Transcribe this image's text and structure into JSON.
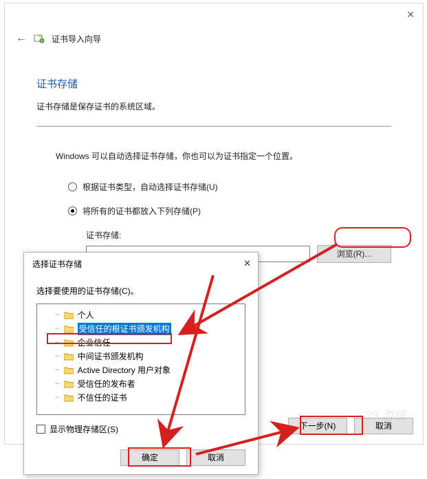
{
  "wizard": {
    "title": "证书导入向导",
    "heading": "证书存储",
    "subheading": "证书存储是保存证书的系统区域。",
    "paragraph": "Windows 可以自动选择证书存储，你也可以为证书指定一个位置。",
    "radio_auto": "根据证书类型，自动选择证书存储(U)",
    "radio_place": "将所有的证书都放入下列存储(P)",
    "store_label": "证书存储:",
    "store_value": "",
    "browse": "浏览(R)...",
    "next": "下一步(N)",
    "cancel": "取消"
  },
  "popup": {
    "title": "选择证书存储",
    "subtitle": "选择要使用的证书存储(C)。",
    "items": [
      "个人",
      "受信任的根证书颁发机构",
      "企业信任",
      "中间证书颁发机构",
      "Active Directory 用户对象",
      "受信任的发布者",
      "不信任的证书"
    ],
    "show_physical": "显示物理存储区(S)",
    "ok": "确定",
    "cancel": "取消"
  },
  "watermark": "39 游侠"
}
